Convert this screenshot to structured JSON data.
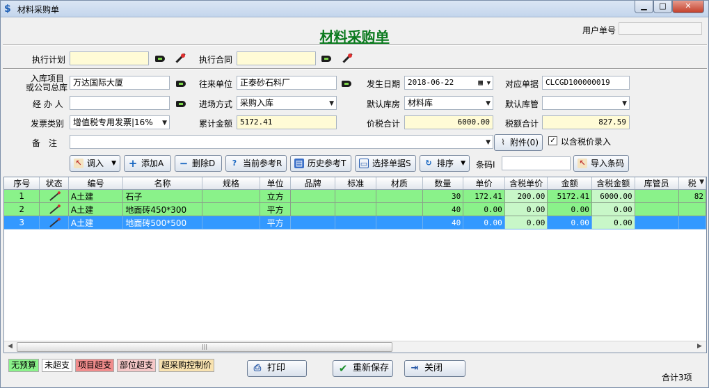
{
  "window": {
    "title": "材料采购单",
    "app_icon": "dollar-app-icon"
  },
  "form_title": "材料采购单",
  "user_no": {
    "label": "用户单号",
    "value": ""
  },
  "exec": {
    "plan_label": "执行计划",
    "plan_value": "",
    "contract_label": "执行合同",
    "contract_value": ""
  },
  "fields": {
    "project_label_1": "入库项目",
    "project_label_2": "或公司总库",
    "project_value": "万达国际大厦",
    "partner_label": "往来单位",
    "partner_value": "正泰砂石料厂",
    "date_label": "发生日期",
    "date_value": "2018-06-22",
    "ref_label": "对应单据",
    "ref_value": "CLCGD100000019",
    "handler_label": "经 办 人",
    "handler_value": "",
    "entry_mode_label": "进场方式",
    "entry_mode_value": "采购入库",
    "warehouse_label": "默认库房",
    "warehouse_value": "材料库",
    "keeper_label": "默认库管",
    "keeper_value": "",
    "invoice_label": "发票类别",
    "invoice_value": "增值税专用发票|16%",
    "accum_label": "累计金额",
    "accum_value": "5172.41",
    "taxsum_label": "价税合计",
    "taxsum_value": "6000.00",
    "tax_label": "税额合计",
    "tax_value": "827.59",
    "remark_label": "备　注",
    "remark_value": "",
    "attach_label": "附件(0)",
    "taxprice_label": "以含税价录入",
    "taxprice_checked": true
  },
  "toolbar": {
    "import_label": "调入",
    "add_label": "添加A",
    "delete_label": "删除D",
    "current_ref_label": "当前参考R",
    "history_ref_label": "历史参考T",
    "select_doc_label": "选择单据S",
    "sort_label": "排序",
    "barcode_label": "条码I",
    "barcode_value": "",
    "import_barcode_label": "导入条码"
  },
  "grid": {
    "columns": [
      "序号",
      "状态",
      "编号",
      "名称",
      "规格",
      "单位",
      "品牌",
      "标准",
      "材质",
      "数量",
      "单价",
      "含税单价",
      "金额",
      "含税金额",
      "库管员",
      "税"
    ],
    "rows": [
      {
        "no": "1",
        "code": "A土建",
        "name": "石子",
        "spec": "",
        "unit": "立方",
        "brand": "",
        "std": "",
        "material": "",
        "qty": "30",
        "price": "172.41",
        "tax_price": "200.00",
        "amount": "5172.41",
        "tax_amount": "6000.00",
        "keeper": "",
        "tax": "82"
      },
      {
        "no": "2",
        "code": "A土建",
        "name": "地面砖450*300",
        "spec": "",
        "unit": "平方",
        "brand": "",
        "std": "",
        "material": "",
        "qty": "40",
        "price": "0.00",
        "tax_price": "0.00",
        "amount": "0.00",
        "tax_amount": "0.00",
        "keeper": "",
        "tax": ""
      },
      {
        "no": "3",
        "code": "A土建",
        "name": "地面砖500*500",
        "spec": "",
        "unit": "平方",
        "brand": "",
        "std": "",
        "material": "",
        "qty": "40",
        "price": "0.00",
        "tax_price": "0.00",
        "amount": "0.00",
        "tax_amount": "0.00",
        "keeper": "",
        "tax": ""
      }
    ]
  },
  "legend": {
    "no_budget": "无预算",
    "not_over": "未超支",
    "project_over": "项目超支",
    "part_over": "部位超支",
    "over_control": "超采购控制价",
    "colors": {
      "no_budget": "#8af28a",
      "not_over": "#ffffff",
      "project_over": "#f08c8c",
      "part_over": "#f5c8c8",
      "over_control": "#f8e2b0"
    }
  },
  "buttons": {
    "print_label": "打印",
    "resave_label": "重新保存",
    "close_label": "关闭"
  },
  "total_label": "合计3项"
}
